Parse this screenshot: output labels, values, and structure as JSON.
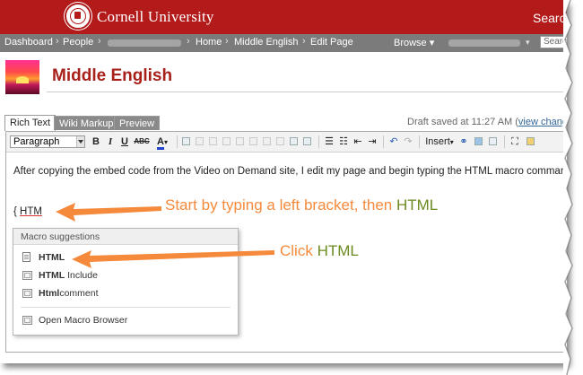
{
  "header": {
    "university": "Cornell University",
    "search_label": "Search"
  },
  "nav": {
    "dashboard": "Dashboard",
    "people": "People",
    "home": "Home",
    "space": "Middle English",
    "edit_page": "Edit Page",
    "browse": "Browse",
    "search_placeholder": "Search"
  },
  "page": {
    "title": "Middle English"
  },
  "tabs": [
    {
      "label": "Rich Text",
      "active": true
    },
    {
      "label": "Wiki Markup",
      "active": false
    },
    {
      "label": "Preview",
      "active": false
    }
  ],
  "draft": {
    "text": "Draft saved at 11:27 AM (",
    "link": "view changes"
  },
  "toolbar": {
    "paragraph": "Paragraph",
    "bold": "B",
    "italic": "I",
    "underline": "U",
    "strike": "ABC",
    "color": "A",
    "insert": "Insert"
  },
  "editor": {
    "body_text": "After copying the embed code from the Video on Demand site, I edit my page and begin typing the HTML macro command.",
    "typed_bracket": "{ ",
    "typed_macro": "HTM"
  },
  "macro_popup": {
    "header": "Macro suggestions",
    "items": [
      {
        "bold": "HTML",
        "rest": ""
      },
      {
        "bold": "HTML",
        "rest": " Include"
      },
      {
        "bold": "Html",
        "rest": "comment"
      }
    ],
    "footer": "Open Macro Browser"
  },
  "annotations": {
    "first_text": "Start by typing a left bracket, then ",
    "first_highlight": "HTML",
    "second_text": "Click ",
    "second_highlight": "HTML"
  },
  "colors": {
    "brand_red": "#b31b1b",
    "title_red": "#a8201a",
    "annotation_orange": "#f58a3c",
    "annotation_green": "#6b8a1f"
  }
}
